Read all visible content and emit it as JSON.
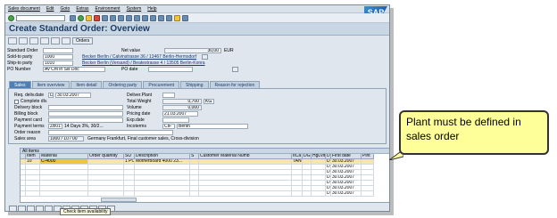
{
  "menu": [
    "Sales document",
    "Edit",
    "Goto",
    "Extras",
    "Environment",
    "System",
    "Help"
  ],
  "logo": "SAP",
  "title": "Create Standard Order: Overview",
  "toolbar2": {
    "orders_label": "Orders"
  },
  "header": {
    "standard_order_label": "Standard Order",
    "net_value_label": "Net value",
    "net_value": "30,00",
    "currency": "EUR",
    "sold_to_label": "Sold-to party",
    "sold_to_value": "1000",
    "sold_to_desc": "Becker Berlin / Calvinstrasse 36 / 13467 Berlin-Hermsdorf",
    "ship_to_label": "Ship-to party",
    "ship_to_value": "1010",
    "ship_to_desc": "Becker Berlin (Versand) / Beatestrasse 4 / 13505 Berlin-Konra",
    "po_number_label": "PO Number",
    "po_number_value": "Av Cht in Sls Doc",
    "po_date_label": "PO date"
  },
  "tabs": [
    "Sales",
    "Item overview",
    "Item detail",
    "Ordering party",
    "Procurement",
    "Shipping",
    "Reason for rejection"
  ],
  "sales": {
    "req_deliv_label": "Req. deliv.date",
    "req_deliv_prefix": "D",
    "req_deliv_value": "30.03.2007",
    "deliver_plant_label": "Deliver.Plant",
    "complete_div_label": "Complete dlv.",
    "total_weight_label": "Total Weight",
    "total_weight_value": "0,700",
    "total_weight_unit": "KG",
    "delivery_block_label": "Delivery block",
    "volume_label": "Volume",
    "volume_value": "0,000",
    "billing_block_label": "Billing block",
    "pricing_date_label": "Pricing date",
    "pricing_date_value": "21.03.2007",
    "payment_card_label": "Payment card",
    "exp_date_label": "Exp.date",
    "payment_terms_label": "Payment terms",
    "payment_terms_value": "ZB01",
    "payment_terms_desc": "14 Days 3%, 30/2...",
    "incoterms_label": "Incoterms",
    "incoterms_value": "CIF",
    "incoterms_place": "Berlin",
    "order_reason_label": "Order reason",
    "sales_area_label": "Sales area",
    "sales_area_value": "1000 / 10 / 00",
    "sales_area_desc": "Germany Frankfurt, Final customer sales, Cross-division"
  },
  "grid": {
    "title": "All items",
    "columns": [
      "Item",
      "Material",
      "Order quantity",
      "SU",
      "Description",
      "S",
      "Customer Material Numb",
      "ItCa",
      "DG",
      "HgLvlt",
      "D",
      "First date",
      "Plnt"
    ],
    "rows": [
      [
        "10",
        "C-4000",
        "",
        "1 PC",
        "Motherboard 4000 23...",
        "",
        "",
        "TAN",
        "",
        "",
        "D",
        "30.03.2007",
        ""
      ],
      [
        "",
        "",
        "",
        "",
        "",
        "",
        "",
        "",
        "",
        "",
        "D",
        "30.03.2007",
        ""
      ],
      [
        "",
        "",
        "",
        "",
        "",
        "",
        "",
        "",
        "",
        "",
        "D",
        "30.03.2007",
        ""
      ],
      [
        "",
        "",
        "",
        "",
        "",
        "",
        "",
        "",
        "",
        "",
        "D",
        "30.03.2007",
        ""
      ],
      [
        "",
        "",
        "",
        "",
        "",
        "",
        "",
        "",
        "",
        "",
        "D",
        "30.03.2007",
        ""
      ],
      [
        "",
        "",
        "",
        "",
        "",
        "",
        "",
        "",
        "",
        "",
        "D",
        "30.03.2007",
        ""
      ],
      [
        "",
        "",
        "",
        "",
        "",
        "",
        "",
        "",
        "",
        "",
        "D",
        "30.03.2007",
        ""
      ]
    ]
  },
  "tooltip": "Check item availability",
  "callout": "Plant must be defined in sales order"
}
